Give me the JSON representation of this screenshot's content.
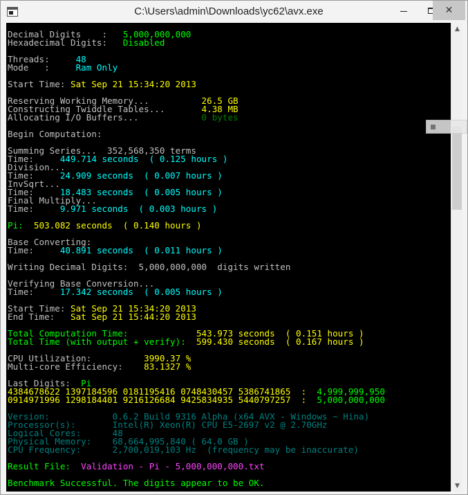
{
  "window": {
    "title": "C:\\Users\\admin\\Downloads\\yc62\\avx.exe",
    "icon": "console-icon",
    "controls": {
      "minimize": "minimize-icon",
      "maximize": "maximize-icon",
      "close": "✕"
    }
  },
  "console": {
    "lines": [
      [
        {
          "t": "Decimal Digits    :   ",
          "c": "gray"
        },
        {
          "t": "5,000,000,000",
          "c": "green"
        }
      ],
      [
        {
          "t": "Hexadecimal Digits:   ",
          "c": "gray"
        },
        {
          "t": "Disabled",
          "c": "green"
        }
      ],
      [
        {
          "t": "",
          "c": "gray"
        }
      ],
      [
        {
          "t": "Threads:     ",
          "c": "gray"
        },
        {
          "t": "48",
          "c": "cyan"
        }
      ],
      [
        {
          "t": "Mode   :     ",
          "c": "gray"
        },
        {
          "t": "Ram Only",
          "c": "cyan"
        }
      ],
      [
        {
          "t": "",
          "c": "gray"
        }
      ],
      [
        {
          "t": "Start Time: ",
          "c": "gray"
        },
        {
          "t": "Sat Sep 21 15:34:20 2013",
          "c": "yellow"
        }
      ],
      [
        {
          "t": "",
          "c": "gray"
        }
      ],
      [
        {
          "t": "Reserving Working Memory...          ",
          "c": "gray"
        },
        {
          "t": "26.5 GB",
          "c": "yellow"
        }
      ],
      [
        {
          "t": "Constructing Twiddle Tables...       ",
          "c": "gray"
        },
        {
          "t": "4.38 MB",
          "c": "yellow"
        }
      ],
      [
        {
          "t": "Allocating I/O Buffers...            ",
          "c": "gray"
        },
        {
          "t": "0 bytes",
          "c": "dkgreen"
        }
      ],
      [
        {
          "t": "",
          "c": "gray"
        }
      ],
      [
        {
          "t": "Begin Computation:",
          "c": "gray"
        }
      ],
      [
        {
          "t": "",
          "c": "gray"
        }
      ],
      [
        {
          "t": "Summing Series...  352,568,350 terms",
          "c": "gray"
        }
      ],
      [
        {
          "t": "Time:     ",
          "c": "gray"
        },
        {
          "t": "449.714 seconds  ( 0.125 hours )",
          "c": "cyan"
        }
      ],
      [
        {
          "t": "Division...",
          "c": "gray"
        }
      ],
      [
        {
          "t": "Time:     ",
          "c": "gray"
        },
        {
          "t": "24.909 seconds  ( 0.007 hours )",
          "c": "cyan"
        }
      ],
      [
        {
          "t": "InvSqrt...",
          "c": "gray"
        }
      ],
      [
        {
          "t": "Time:     ",
          "c": "gray"
        },
        {
          "t": "18.483 seconds  ( 0.005 hours )",
          "c": "cyan"
        }
      ],
      [
        {
          "t": "Final Multiply...",
          "c": "gray"
        }
      ],
      [
        {
          "t": "Time:     ",
          "c": "gray"
        },
        {
          "t": "9.971 seconds  ( 0.003 hours )",
          "c": "cyan"
        }
      ],
      [
        {
          "t": "",
          "c": "gray"
        }
      ],
      [
        {
          "t": "Pi:  ",
          "c": "green"
        },
        {
          "t": "503.082 seconds  ( 0.140 hours )",
          "c": "yellow"
        }
      ],
      [
        {
          "t": "",
          "c": "gray"
        }
      ],
      [
        {
          "t": "Base Converting:",
          "c": "gray"
        }
      ],
      [
        {
          "t": "Time:     ",
          "c": "gray"
        },
        {
          "t": "40.891 seconds  ( 0.011 hours )",
          "c": "cyan"
        }
      ],
      [
        {
          "t": "",
          "c": "gray"
        }
      ],
      [
        {
          "t": "Writing Decimal Digits:  5,000,000,000  digits written",
          "c": "gray"
        }
      ],
      [
        {
          "t": "",
          "c": "gray"
        }
      ],
      [
        {
          "t": "Verifying Base Conversion...",
          "c": "gray"
        }
      ],
      [
        {
          "t": "Time:     ",
          "c": "gray"
        },
        {
          "t": "17.342 seconds  ( 0.005 hours )",
          "c": "cyan"
        }
      ],
      [
        {
          "t": "",
          "c": "gray"
        }
      ],
      [
        {
          "t": "Start Time: ",
          "c": "gray"
        },
        {
          "t": "Sat Sep 21 15:34:20 2013",
          "c": "yellow"
        }
      ],
      [
        {
          "t": "End Time:   ",
          "c": "gray"
        },
        {
          "t": "Sat Sep 21 15:44:20 2013",
          "c": "yellow"
        }
      ],
      [
        {
          "t": "",
          "c": "gray"
        }
      ],
      [
        {
          "t": "Total Computation Time:             ",
          "c": "green"
        },
        {
          "t": "543.973 seconds  ( 0.151 hours )",
          "c": "yellow"
        }
      ],
      [
        {
          "t": "Total Time (with output + verify):  ",
          "c": "green"
        },
        {
          "t": "599.430 seconds  ( 0.167 hours )",
          "c": "yellow"
        }
      ],
      [
        {
          "t": "",
          "c": "gray"
        }
      ],
      [
        {
          "t": "CPU Utilization:          ",
          "c": "gray"
        },
        {
          "t": "3990.37 %",
          "c": "yellow"
        }
      ],
      [
        {
          "t": "Multi-core Efficiency:    ",
          "c": "gray"
        },
        {
          "t": "83.1327 %",
          "c": "yellow"
        }
      ],
      [
        {
          "t": "",
          "c": "gray"
        }
      ],
      [
        {
          "t": "Last Digits:  ",
          "c": "gray"
        },
        {
          "t": "Pi",
          "c": "green"
        }
      ],
      [
        {
          "t": "4384678622 1397184596 0181195416 0748430457 5386741865  :  ",
          "c": "yellow"
        },
        {
          "t": "4,999,999,950",
          "c": "green"
        }
      ],
      [
        {
          "t": "0914971996 1298184401 9216126684 9425834935 5440797257  :  ",
          "c": "yellow"
        },
        {
          "t": "5,000,000,000",
          "c": "green"
        }
      ],
      [
        {
          "t": "",
          "c": "gray"
        }
      ],
      [
        {
          "t": "Version:            0.6.2 Build 9316 Alpha (x64 AVX - Windows ~ Hina)",
          "c": "teal"
        }
      ],
      [
        {
          "t": "Processor(s):       Intel(R) Xeon(R) CPU E5-2697 v2 @ 2.70GHz",
          "c": "teal"
        }
      ],
      [
        {
          "t": "Logical Cores:      48",
          "c": "teal"
        }
      ],
      [
        {
          "t": "Physical Memory:    68,664,995,840 ( 64.0 GB )",
          "c": "teal"
        }
      ],
      [
        {
          "t": "CPU Frequency:      2,700,019,103 Hz  (frequency may be inaccurate)",
          "c": "teal"
        }
      ],
      [
        {
          "t": "",
          "c": "gray"
        }
      ],
      [
        {
          "t": "Result File:  ",
          "c": "green"
        },
        {
          "t": "Validation - Pi - 5,000,000,000.txt",
          "c": "magenta"
        }
      ],
      [
        {
          "t": "",
          "c": "gray"
        }
      ],
      [
        {
          "t": "Benchmark Successful. The digits appear to be OK.",
          "c": "green"
        }
      ]
    ]
  },
  "scrollbar": {
    "up": "▲",
    "down": "▼"
  }
}
